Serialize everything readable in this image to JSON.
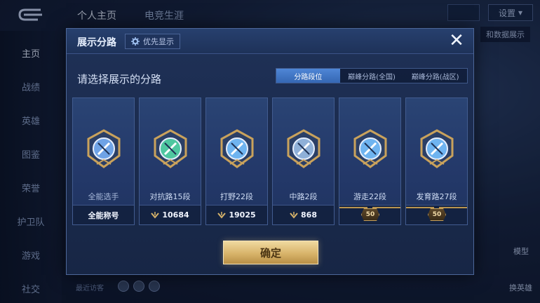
{
  "background": {
    "top_tabs": [
      "个人主页",
      "电竞生涯"
    ],
    "settings_label": "设置",
    "sidebar": [
      "主页",
      "战绩",
      "英雄",
      "图鉴",
      "荣誉",
      "护卫队",
      "游戏",
      "社交"
    ],
    "visitors_label": "最近访客",
    "right_panel_label": "和数据展示",
    "model_label": "模型",
    "switch_hero_label": "换英雄"
  },
  "modal": {
    "title": "展示分路",
    "priority_label": "优先显示",
    "close_glyph": "✕",
    "subtitle": "请选择展示的分路",
    "tabs": [
      "分路段位",
      "巅峰分路(全国)",
      "巅峰分路(战区)"
    ],
    "active_tab": 0,
    "cards": [
      {
        "name": "全能选手",
        "footer": "全能称号",
        "type": "title",
        "emblem": "all-round-emblem-icon",
        "color": "#6fa3e6"
      },
      {
        "name": "对抗路15段",
        "footer": "10684",
        "type": "score",
        "emblem": "clash-lane-emblem-icon",
        "color": "#4fc7a0"
      },
      {
        "name": "打野22段",
        "footer": "19025",
        "type": "score",
        "emblem": "jungle-emblem-icon",
        "color": "#6fb4f0"
      },
      {
        "name": "中路2段",
        "footer": "868",
        "type": "score",
        "emblem": "mid-lane-emblem-icon",
        "color": "#8fb0d8"
      },
      {
        "name": "游走22段",
        "footer": "50",
        "type": "level",
        "emblem": "roam-emblem-icon",
        "color": "#6fb4f0"
      },
      {
        "name": "发育路27段",
        "footer": "50",
        "type": "level",
        "emblem": "farm-lane-emblem-icon",
        "color": "#6fb4f0"
      }
    ],
    "confirm_label": "确定"
  },
  "colors": {
    "gold": "#d8b46a",
    "tab_active": "#3f76c6"
  }
}
